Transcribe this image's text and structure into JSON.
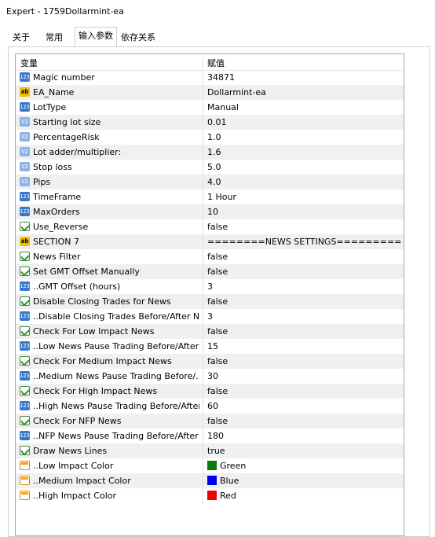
{
  "window": {
    "title": "Expert - 1759Dollarmint-ea"
  },
  "tabs": [
    {
      "label": "关于"
    },
    {
      "label": "常用"
    },
    {
      "label": "输入参数"
    },
    {
      "label": "依存关系"
    }
  ],
  "table": {
    "col_variable": "变量",
    "col_value": "赋值",
    "rows": [
      {
        "icon": "int-icon",
        "name": "Magic number",
        "value": "34871"
      },
      {
        "icon": "string-icon",
        "name": "EA_Name",
        "value": "Dollarmint-ea"
      },
      {
        "icon": "int-icon",
        "name": "LotType",
        "value": "Manual"
      },
      {
        "icon": "double-icon",
        "name": "Starting lot size",
        "value": "0.01"
      },
      {
        "icon": "double-icon",
        "name": "PercentageRisk",
        "value": "1.0"
      },
      {
        "icon": "double-icon",
        "name": "Lot adder/multiplier:",
        "value": "1.6"
      },
      {
        "icon": "double-icon",
        "name": "Stop loss",
        "value": "5.0"
      },
      {
        "icon": "double-icon",
        "name": "Pips",
        "value": "4.0"
      },
      {
        "icon": "int-icon",
        "name": "TimeFrame",
        "value": "1 Hour"
      },
      {
        "icon": "int-icon",
        "name": "MaxOrders",
        "value": "10"
      },
      {
        "icon": "bool-icon",
        "name": "Use_Reverse",
        "value": "false"
      },
      {
        "icon": "string-icon",
        "name": "SECTION 7",
        "value": "========NEWS SETTINGS========="
      },
      {
        "icon": "bool-icon",
        "name": "News Filter",
        "value": "false"
      },
      {
        "icon": "bool-icon",
        "name": "Set GMT Offset Manually",
        "value": "false"
      },
      {
        "icon": "int-icon",
        "name": "..GMT Offset (hours)",
        "value": "3"
      },
      {
        "icon": "bool-icon",
        "name": "Disable Closing Trades for News",
        "value": "false"
      },
      {
        "icon": "int-icon",
        "name": "..Disable Closing Trades Before/After N...",
        "value": "3"
      },
      {
        "icon": "bool-icon",
        "name": "Check For Low Impact News",
        "value": "false"
      },
      {
        "icon": "int-icon",
        "name": "..Low News Pause Trading Before/After ...",
        "value": "15"
      },
      {
        "icon": "bool-icon",
        "name": "Check For Medium Impact News",
        "value": "false"
      },
      {
        "icon": "int-icon",
        "name": "..Medium News Pause Trading Before/...",
        "value": "30"
      },
      {
        "icon": "bool-icon",
        "name": "Check For High Impact  News",
        "value": "false"
      },
      {
        "icon": "int-icon",
        "name": "..High News Pause Trading Before/After...",
        "value": "60"
      },
      {
        "icon": "bool-icon",
        "name": "Check For NFP News",
        "value": "false"
      },
      {
        "icon": "int-icon",
        "name": "..NFP News Pause Trading Before/After ...",
        "value": "180"
      },
      {
        "icon": "bool-icon",
        "name": "Draw News Lines",
        "value": "true"
      },
      {
        "icon": "color-icon",
        "name": "..Low Impact Color",
        "value": "Green",
        "swatch": "#0a7a0a"
      },
      {
        "icon": "color-icon",
        "name": "..Medium Impact Color",
        "value": "Blue",
        "swatch": "#0000ee"
      },
      {
        "icon": "color-icon",
        "name": "..High Impact Color",
        "value": "Red",
        "swatch": "#ee0000"
      }
    ]
  }
}
